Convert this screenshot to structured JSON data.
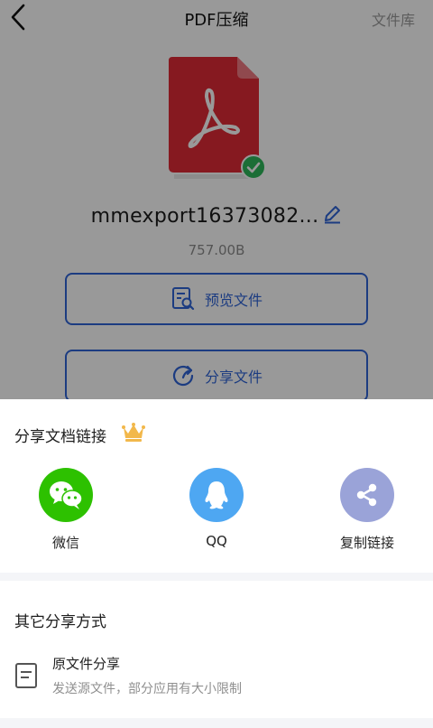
{
  "header": {
    "title": "PDF压缩",
    "library_label": "文件库"
  },
  "file": {
    "name": "mmexport16373082...",
    "size": "757.00B",
    "status": "compressed"
  },
  "actions": {
    "preview_label": "预览文件",
    "share_label": "分享文件"
  },
  "share_sheet": {
    "links_title": "分享文档链接",
    "targets": [
      {
        "label": "微信",
        "icon": "wechat-icon",
        "color": "#2dc100"
      },
      {
        "label": "QQ",
        "icon": "qq-icon",
        "color": "#4ea7f2"
      },
      {
        "label": "复制链接",
        "icon": "share-link-icon",
        "color": "#9aa3d8"
      }
    ],
    "other_title": "其它分享方式",
    "original": {
      "title": "原文件分享",
      "description": "发送源文件，部分应用有大小限制"
    }
  },
  "colors": {
    "accent": "#2f64d8",
    "pdf_red": "#e02a36",
    "success": "#2db85a",
    "crown": "#f2b84b"
  }
}
